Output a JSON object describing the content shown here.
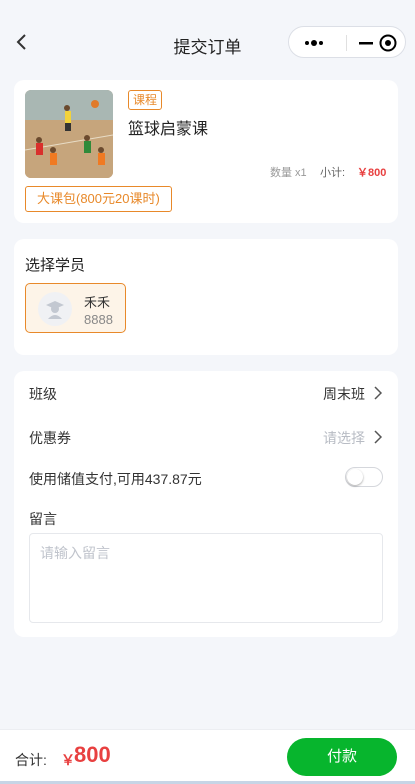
{
  "header": {
    "title": "提交订单"
  },
  "course": {
    "tag": "课程",
    "name": "篮球启蒙课",
    "quantity": "数量 x1",
    "subtotal_label": "小计:",
    "subtotal_value": "￥800",
    "package": "大课包(800元20课时)"
  },
  "student_section": {
    "title": "选择学员",
    "student": {
      "name": "禾禾",
      "id": "8888"
    }
  },
  "options": {
    "class_label": "班级",
    "class_value": "周末班",
    "coupon_label": "优惠券",
    "coupon_value": "请选择",
    "balance_label": "使用储值支付,可用437.87元",
    "balance_toggle_on": false,
    "memo_label": "留言",
    "memo_placeholder": "请输入留言"
  },
  "footer": {
    "total_label": "合计:",
    "total_symbol": "￥",
    "total_value": "800",
    "pay_label": "付款"
  },
  "colors": {
    "accent_orange": "#e8892a",
    "price_red": "#e84040",
    "pay_green": "#07b52d"
  }
}
